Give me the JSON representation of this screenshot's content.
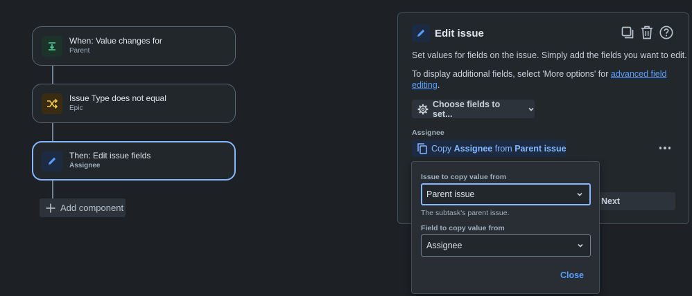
{
  "flow": {
    "nodes": [
      {
        "title": "When: Value changes for",
        "subtitle": "Parent",
        "icon": "trigger-icon"
      },
      {
        "title": "Issue Type does not equal",
        "subtitle": "Epic",
        "icon": "condition-shuffle-icon"
      },
      {
        "title": "Then: Edit issue fields",
        "subtitle": "Assignee",
        "icon": "pencil-icon"
      }
    ],
    "add_component_label": "Add component"
  },
  "panel": {
    "title": "Edit issue",
    "description": "Set values for fields on the issue. Simply add the fields you want to edit.",
    "more_info_prefix": "To display additional fields, select 'More options' for ",
    "more_info_link": "advanced field editing",
    "more_info_suffix": ".",
    "choose_fields_label": "Choose fields to set...",
    "field_label": "Assignee",
    "copy_button": {
      "prefix": "Copy ",
      "field": "Assignee",
      "middle": " from ",
      "source": "Parent issue"
    },
    "next_label": "Next"
  },
  "popover": {
    "issue_label": "Issue to copy value from",
    "issue_value": "Parent issue",
    "issue_helper": "The subtask's parent issue.",
    "field_label": "Field to copy value from",
    "field_value": "Assignee",
    "close_label": "Close"
  },
  "colors": {
    "background": "#1d2125",
    "accent": "#579dff",
    "selected_border": "#85b8ff",
    "trigger_green": "#4bce97",
    "condition_yellow": "#f5cd47"
  }
}
